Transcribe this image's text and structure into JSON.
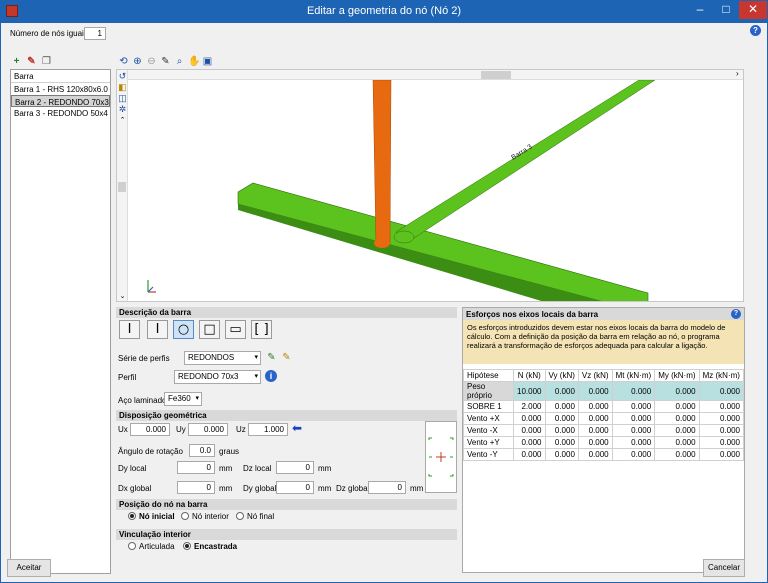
{
  "window": {
    "title": "Editar a geometria do nó (Nó 2)",
    "min": "–",
    "max": "□",
    "close": "✕"
  },
  "header": {
    "equal_nodes_label": "Número de nós iguais",
    "equal_nodes_value": "1",
    "help": "?"
  },
  "bars": {
    "header": "Barra",
    "items": [
      "Barra 1 - RHS 120x80x6.0",
      "Barra 2 - REDONDO 70x3",
      "Barra 3 - REDONDO 50x4"
    ]
  },
  "viewport": {
    "label_barra3": "Barra 3"
  },
  "descricao": {
    "title": "Descrição da barra",
    "serie_label": "Série de perfis",
    "serie_value": "REDONDOS",
    "perfil_label": "Perfil",
    "perfil_value": "REDONDO 70x3",
    "aco_label": "Aço laminado",
    "aco_value": "Fe360"
  },
  "disposicao": {
    "title": "Disposição geométrica",
    "ux_label": "Ux",
    "ux_value": "0.000",
    "uy_label": "Uy",
    "uy_value": "0.000",
    "uz_label": "Uz",
    "uz_value": "1.000",
    "rot_label": "Ângulo de rotação",
    "rot_value": "0.0",
    "rot_unit": "graus",
    "dy_local_label": "Dy local",
    "dy_local_value": "0",
    "dz_local_label": "Dz local",
    "dz_local_value": "0",
    "dx_global_label": "Dx global",
    "dx_global_value": "0",
    "dy_global_label": "Dy global",
    "dy_global_value": "0",
    "dz_global_label": "Dz global",
    "dz_global_value": "0",
    "mm": "mm"
  },
  "posicao": {
    "title": "Posição do nó na barra",
    "options": [
      "Nó inicial",
      "Nó interior",
      "Nó final"
    ],
    "selected": 0
  },
  "vinculacao": {
    "title": "Vinculação interior",
    "options": [
      "Articulada",
      "Encastrada"
    ],
    "selected": 1
  },
  "esforcos": {
    "title": "Esforços nos eixos locais da barra",
    "help": "?",
    "info": "Os esforços introduzidos devem estar nos eixos locais da barra do modelo de cálculo. Com a definição da posição da barra em relação ao nó, o programa realizará a transformação de esforços adequada para calcular a ligação.",
    "columns": [
      "Hipótese",
      "N (kN)",
      "Vy (kN)",
      "Vz (kN)",
      "Mt (kN·m)",
      "My (kN·m)",
      "Mz (kN·m)"
    ],
    "rows": [
      [
        "Peso próprio",
        "10.000",
        "0.000",
        "0.000",
        "0.000",
        "0.000",
        "0.000"
      ],
      [
        "SOBRE 1",
        "2.000",
        "0.000",
        "0.000",
        "0.000",
        "0.000",
        "0.000"
      ],
      [
        "Vento +X",
        "0.000",
        "0.000",
        "0.000",
        "0.000",
        "0.000",
        "0.000"
      ],
      [
        "Vento -X",
        "0.000",
        "0.000",
        "0.000",
        "0.000",
        "0.000",
        "0.000"
      ],
      [
        "Vento +Y",
        "0.000",
        "0.000",
        "0.000",
        "0.000",
        "0.000",
        "0.000"
      ],
      [
        "Vento -Y",
        "0.000",
        "0.000",
        "0.000",
        "0.000",
        "0.000",
        "0.000"
      ]
    ]
  },
  "footer": {
    "accept": "Aceitar",
    "cancel": "Cancelar"
  },
  "colors": {
    "titlebar": "#1e64b4",
    "beam_green": "#5cc21e",
    "bar_orange": "#e86a10",
    "info_bg": "#f3e3b5",
    "selected_row": "#b9e0e0"
  }
}
